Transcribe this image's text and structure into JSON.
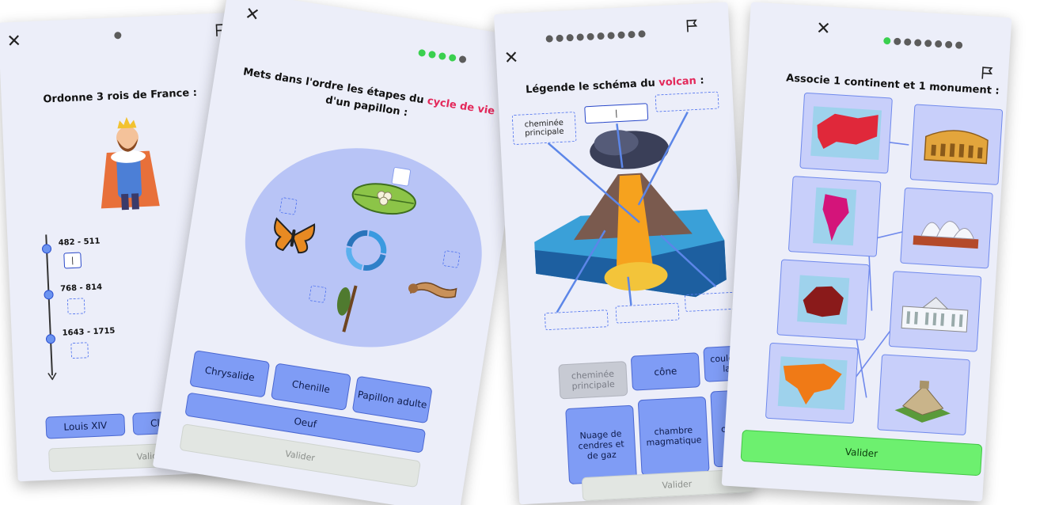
{
  "card1": {
    "close": "✕",
    "title": "Ordonne 3 rois de France :",
    "timeline": [
      {
        "label": "482 - 511",
        "value": "|"
      },
      {
        "label": "768 - 814",
        "value": ""
      },
      {
        "label": "1643 - 1715",
        "value": ""
      }
    ],
    "options": [
      "Louis XIV",
      "Clovis Ier"
    ],
    "validate": "Valider"
  },
  "card2": {
    "close": "✕",
    "title_part1": "Mets dans l'ordre les étapes du ",
    "title_accent": "cycle de vie",
    "title_part2": "d'un papillon :",
    "options": [
      "Chrysalide",
      "Chenille",
      "Papillon adulte",
      "Oeuf"
    ],
    "validate": "Valider"
  },
  "card3": {
    "close": "✕",
    "title_part1": "Légende le schéma du ",
    "title_accent": "volcan",
    "title_part2": " :",
    "slots": [
      "cheminée principale",
      "|"
    ],
    "options": [
      "cheminée principale",
      "cône",
      "coulée de lave",
      "Nuage de cendres et de gaz",
      "chambre magmatique",
      "c... p..."
    ],
    "validate": "Valider"
  },
  "card4": {
    "close": "✕",
    "title": "Associe 1 continent et 1 monument :",
    "validate": "Valider"
  },
  "colors": {
    "accent": "#e3285a",
    "button": "#7f9cf5",
    "success": "#6df06f",
    "progress_done": "#3ad04f"
  }
}
